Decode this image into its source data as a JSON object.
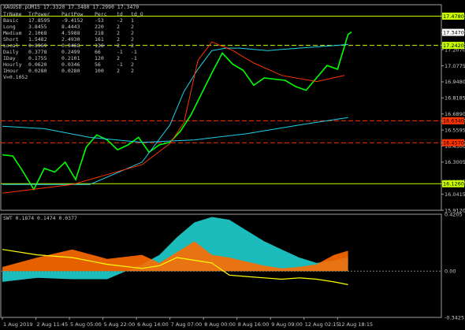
{
  "chart_data": [
    {
      "type": "line",
      "symbol_header": "XAGUSD.pUM15  17.3320 17.3480 17.2990 17.3470",
      "table": {
        "headers": [
          "TrName",
          "TrPower",
          "PartPow",
          "Perc",
          "td",
          "td_O"
        ],
        "rows": [
          [
            "Basic",
            "17.8595",
            "-9.4152",
            "-53",
            "-2",
            "1"
          ],
          [
            "Long",
            "3.8455",
            "8.4443",
            "220",
            "2",
            "2"
          ],
          [
            "Medium",
            "2.1068",
            "4.5988",
            "218",
            "2",
            "2"
          ],
          [
            "Short",
            "1.5482",
            "2.4930",
            "161",
            "2",
            "2"
          ],
          [
            "Local",
            "0.8969",
            "0.9468",
            "136",
            "2",
            "2"
          ],
          [
            "Daily",
            "0.3778",
            "0.2499",
            "66",
            "-1",
            "-1"
          ],
          [
            "IDay",
            "0.1755",
            "0.2101",
            "120",
            "2",
            "-1"
          ],
          [
            "Hourly",
            "0.0620",
            "0.0346",
            "56",
            "-1",
            "2"
          ],
          [
            "IHour",
            "0.0280",
            "0.0280",
            "100",
            "2",
            "2"
          ]
        ],
        "footer": "V=0.1052"
      },
      "y_ticks": [
        "17.4780",
        "17.3470",
        "17.2420",
        "17.2070",
        "17.0775",
        "16.9480",
        "16.8185",
        "16.6890",
        "16.6340",
        "16.5595",
        "16.4570",
        "16.4300",
        "16.3005",
        "16.1435",
        "16.1260",
        "16.0415",
        "15.9120"
      ],
      "ylim": [
        15.912,
        17.57
      ],
      "x_ticks": [
        "1 Aug 2019",
        "2 Aug 11:45",
        "5 Aug 05:00",
        "5 Aug 22:00",
        "6 Aug 14:00",
        "7 Aug 07:00",
        "8 Aug 00:00",
        "8 Aug 16:00",
        "9 Aug 09:00",
        "12 Aug 02:15",
        "12 Aug 18:15"
      ],
      "price_levels": [
        {
          "value": 17.478,
          "label": "17.4780",
          "color": "#c8ff00",
          "style": "solid"
        },
        {
          "value": 17.242,
          "label": "17.2420",
          "color": "#c8ff00",
          "style": "dashed"
        },
        {
          "value": 16.634,
          "label": "16.6340",
          "color": "#ff3300",
          "style": "dashed"
        },
        {
          "value": 16.457,
          "label": "16.4570",
          "color": "#ff3300",
          "style": "dashed"
        },
        {
          "value": 16.126,
          "label": "16.1260",
          "color": "#c8ff00",
          "style": "solid"
        }
      ],
      "current_price": {
        "value": 17.347,
        "label": "17.3470"
      },
      "series": [
        {
          "color": "#00ff00",
          "x": [
            0,
            3,
            6,
            9,
            12,
            15,
            18,
            21,
            24,
            27,
            30,
            33,
            36,
            39,
            42,
            45,
            48,
            51,
            54,
            57,
            60,
            63,
            66,
            69,
            72,
            75,
            78,
            81,
            84,
            87,
            90,
            93,
            96,
            99,
            100
          ],
          "values": [
            16.36,
            16.35,
            16.22,
            16.08,
            16.25,
            16.22,
            16.3,
            16.16,
            16.42,
            16.52,
            16.48,
            16.4,
            16.44,
            16.5,
            16.38,
            16.44,
            16.46,
            16.55,
            16.68,
            16.85,
            17.02,
            17.18,
            17.09,
            17.04,
            16.92,
            16.98,
            16.97,
            16.96,
            16.91,
            16.88,
            16.98,
            17.08,
            17.05,
            17.33,
            17.35
          ]
        },
        {
          "color": "#20d0e8",
          "x": [
            0,
            12,
            25,
            40,
            48,
            52,
            56,
            60,
            64,
            68,
            72,
            76,
            80,
            85,
            90,
            95,
            99
          ],
          "values": [
            16.12,
            16.12,
            16.12,
            16.3,
            16.6,
            16.87,
            17.05,
            17.2,
            17.22,
            17.22,
            17.21,
            17.2,
            17.21,
            17.22,
            17.23,
            17.24,
            17.25
          ]
        },
        {
          "color": "#20d0e8",
          "x": [
            0,
            12,
            25,
            40,
            55,
            70,
            85,
            99
          ],
          "values": [
            16.59,
            16.57,
            16.5,
            16.46,
            16.48,
            16.53,
            16.6,
            16.66
          ]
        },
        {
          "color": "#ff3300",
          "x": [
            0,
            20,
            30,
            40,
            48,
            52,
            56,
            60,
            66,
            72,
            80,
            90,
            98
          ],
          "values": [
            16.05,
            16.12,
            16.2,
            16.28,
            16.45,
            16.62,
            17.12,
            17.27,
            17.2,
            17.1,
            17.0,
            16.95,
            17.0
          ]
        }
      ]
    },
    {
      "type": "area",
      "title": "SWT 0.1874 0.1474 0.0377",
      "ylim": [
        -0.3425,
        0.4205
      ],
      "y_ticks": [
        "0.4205",
        "0.00",
        "-0.3425"
      ],
      "series": [
        {
          "color": "#20d0d0",
          "x": [
            0,
            10,
            20,
            30,
            40,
            45,
            50,
            55,
            60,
            65,
            70,
            75,
            80,
            85,
            90,
            95,
            99
          ],
          "values": [
            -0.08,
            -0.05,
            -0.06,
            -0.06,
            0.05,
            0.12,
            0.25,
            0.36,
            0.4,
            0.38,
            0.3,
            0.22,
            0.16,
            0.1,
            0.06,
            0.08,
            0.1
          ]
        },
        {
          "color": "#ff6a00",
          "x": [
            0,
            10,
            20,
            30,
            40,
            45,
            50,
            55,
            60,
            65,
            70,
            75,
            80,
            85,
            90,
            95,
            99
          ],
          "values": [
            0.03,
            0.1,
            0.16,
            0.09,
            0.12,
            0.06,
            0.14,
            0.22,
            0.12,
            0.1,
            0.07,
            0.04,
            0.02,
            0.03,
            0.05,
            0.12,
            0.15
          ]
        },
        {
          "color": "#ffff00",
          "x": [
            0,
            10,
            20,
            30,
            40,
            45,
            50,
            55,
            60,
            65,
            70,
            75,
            80,
            85,
            90,
            95,
            99
          ],
          "values": [
            0.16,
            0.12,
            0.1,
            0.05,
            0.02,
            0.04,
            0.1,
            0.08,
            0.06,
            -0.03,
            -0.04,
            -0.05,
            -0.06,
            -0.05,
            -0.06,
            -0.08,
            -0.1
          ]
        }
      ]
    }
  ]
}
